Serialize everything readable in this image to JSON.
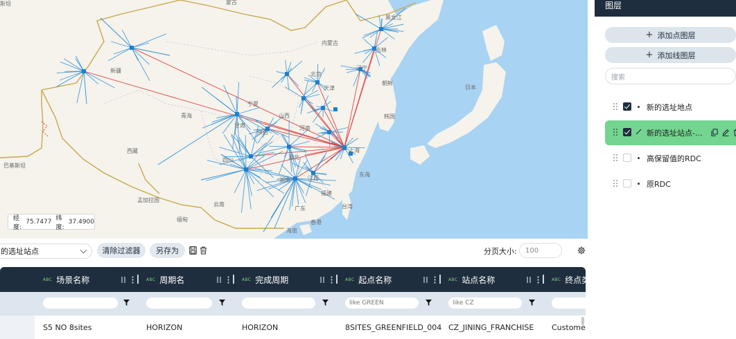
{
  "map": {
    "places": [
      {
        "name": "斯坦",
        "size": "small"
      },
      {
        "name": "蒙古",
        "size": "small"
      },
      {
        "name": "新疆",
        "size": "small"
      },
      {
        "name": "内蒙古",
        "size": "small"
      },
      {
        "name": "青海",
        "size": "small"
      },
      {
        "name": "西藏",
        "size": "small"
      },
      {
        "name": "巴基斯坦",
        "size": "small"
      },
      {
        "name": "甘肃",
        "size": "small"
      },
      {
        "name": "四川",
        "size": "small"
      },
      {
        "name": "湖南",
        "size": "small"
      },
      {
        "name": "江西",
        "size": "small"
      },
      {
        "name": "福建",
        "size": "small"
      },
      {
        "name": "云南",
        "size": "small"
      },
      {
        "name": "广东",
        "size": "small"
      },
      {
        "name": "缅甸",
        "size": "small"
      },
      {
        "name": "孟加拉国",
        "size": "small"
      },
      {
        "name": "香港",
        "size": "small"
      },
      {
        "name": "台湾",
        "size": "small"
      },
      {
        "name": "东海",
        "size": "small"
      },
      {
        "name": "黑龙江",
        "size": "small"
      },
      {
        "name": "吉林",
        "size": "small"
      },
      {
        "name": "朝鲜",
        "size": "small"
      },
      {
        "name": "韩国",
        "size": "small"
      },
      {
        "name": "日本",
        "size": "small"
      },
      {
        "name": "河南",
        "size": "small"
      },
      {
        "name": "山西",
        "size": "small"
      },
      {
        "name": "陕西",
        "size": "small"
      },
      {
        "name": "宁夏",
        "size": "small"
      },
      {
        "name": "湖北",
        "size": "small"
      },
      {
        "name": "上海",
        "size": "small"
      },
      {
        "name": "北京",
        "size": "small"
      },
      {
        "name": "天津",
        "size": "small"
      },
      {
        "name": "辽宁",
        "size": "small"
      },
      {
        "name": "海南",
        "size": "small"
      }
    ],
    "coords": {
      "lng_label": "经度:",
      "lng": "75.7477",
      "lat_label": "纬度:",
      "lat": "37.4900"
    }
  },
  "toolbar": {
    "selected_view": "的选址站点",
    "clear_filter": "清除过滤器",
    "save_as": "另存为",
    "page_size_label": "分页大小:",
    "page_size_placeholder": "100"
  },
  "table": {
    "type_tag": "ABC",
    "columns": [
      "场景名称",
      "周期名",
      "完成周期",
      "起点名称",
      "站点名称",
      "终点类"
    ],
    "filter_placeholders": [
      "",
      "",
      "",
      "like GREEN",
      "like CZ",
      ""
    ],
    "rows": [
      [
        "S5 NO 8sites",
        "HORIZON",
        "HORIZON",
        "8SITES_GREENFIELD_004",
        "CZ_JINING_FRANCHISE",
        "Custome"
      ]
    ]
  },
  "panel": {
    "title": "图层",
    "add_point_layer": "添加点图层",
    "add_line_layer": "添加线图层",
    "search_placeholder": "搜索",
    "layers": [
      {
        "name": "新的选址地点",
        "checked": true,
        "active": false,
        "kind": "point"
      },
      {
        "name": "新的选址站点-...",
        "checked": true,
        "active": true,
        "kind": "line"
      },
      {
        "name": "高保留值的RDC",
        "checked": false,
        "active": false,
        "kind": "point"
      },
      {
        "name": "原RDC",
        "checked": false,
        "active": false,
        "kind": "point"
      }
    ]
  },
  "colors": {
    "sea": "#a9d3f2",
    "land": "#f5f3ec",
    "border": "#c9a74a",
    "spoke": "#2f8fd8",
    "flow": "#e0393b",
    "header": "#1f2e3e",
    "active_layer": "#73d58f"
  }
}
